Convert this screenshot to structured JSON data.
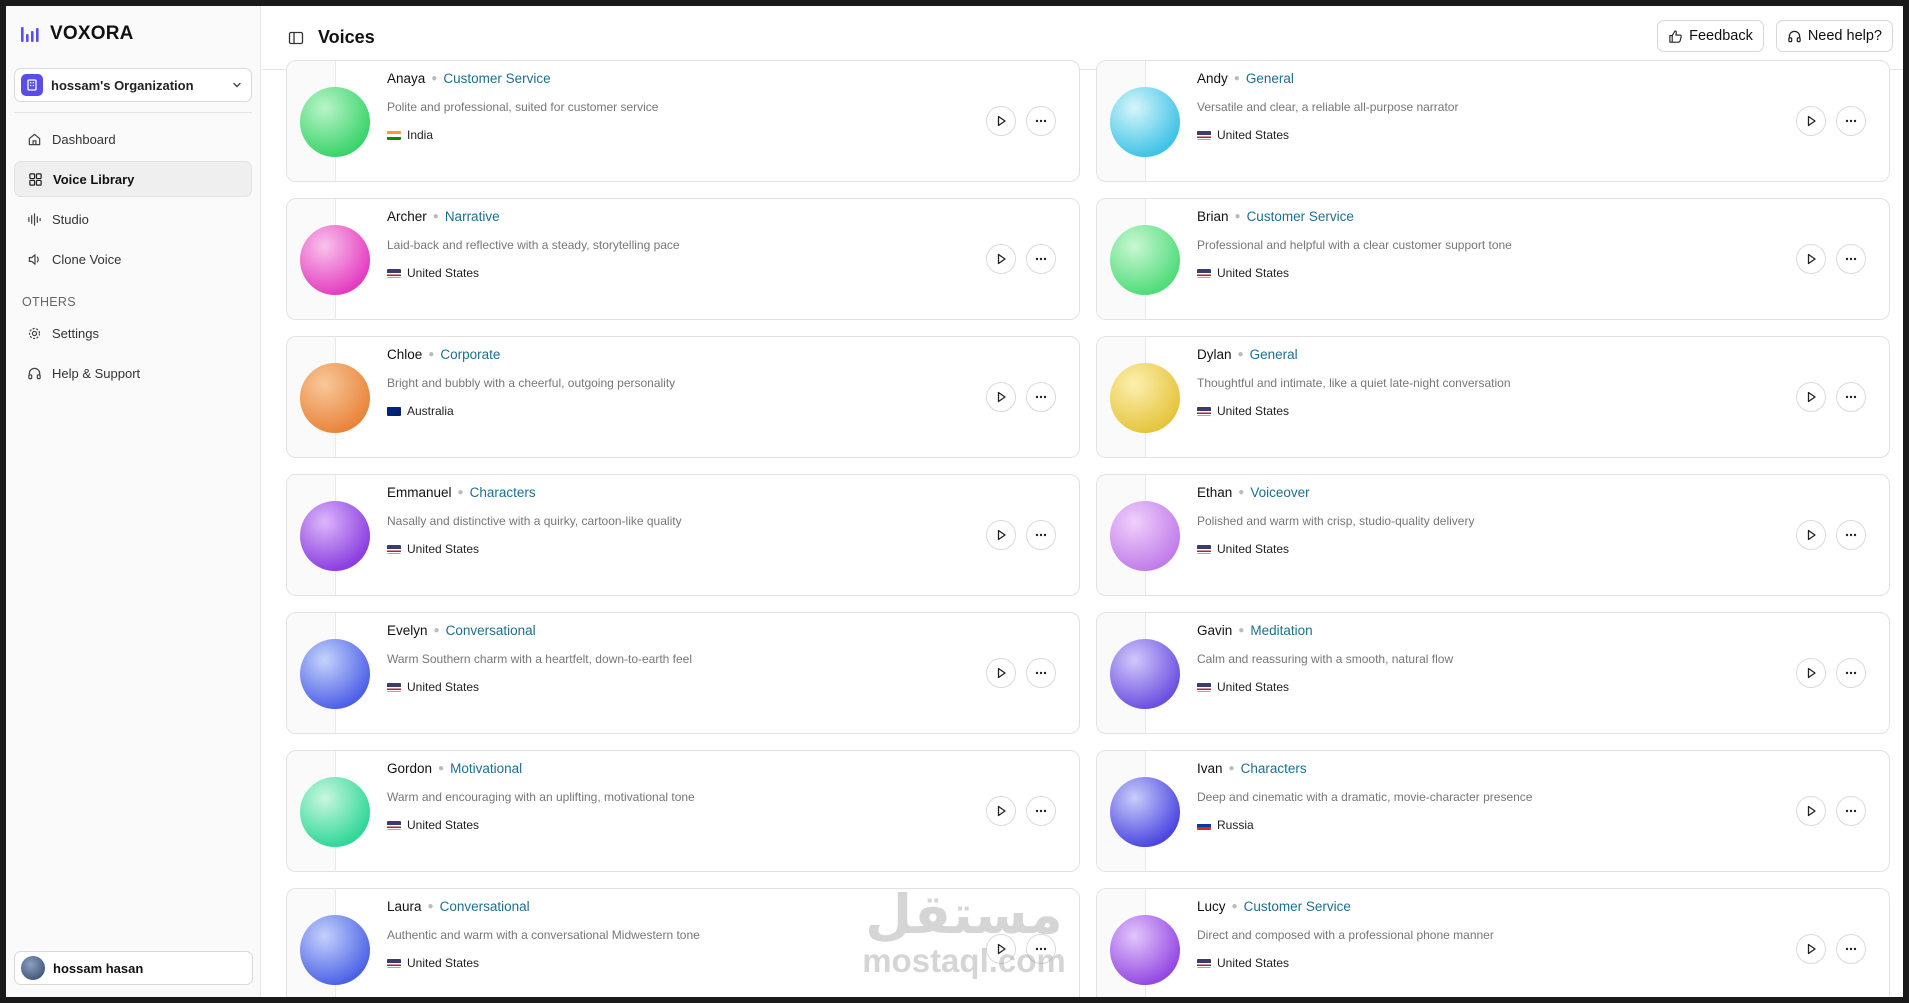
{
  "app": {
    "brand": "VOXORA"
  },
  "sidebar": {
    "org_name": "hossam's Organization",
    "nav": [
      {
        "label": "Dashboard",
        "icon": "home-icon",
        "active": false
      },
      {
        "label": "Voice Library",
        "icon": "grid-icon",
        "active": true
      },
      {
        "label": "Studio",
        "icon": "waveform-icon",
        "active": false
      },
      {
        "label": "Clone Voice",
        "icon": "speaker-icon",
        "active": false
      }
    ],
    "others_label": "OTHERS",
    "others": [
      {
        "label": "Settings",
        "icon": "gear-icon"
      },
      {
        "label": "Help & Support",
        "icon": "headphones-icon"
      }
    ],
    "user_name": "hossam hasan"
  },
  "header": {
    "title": "Voices",
    "feedback_label": "Feedback",
    "help_label": "Need help?"
  },
  "voices": [
    {
      "name": "Anaya",
      "tag": "Customer Service",
      "desc": "Polite and professional, suited for customer service",
      "country": "India",
      "flag": "in",
      "color1": "#b8f5c8",
      "color2": "#3ad36a"
    },
    {
      "name": "Andy",
      "tag": "General",
      "desc": "Versatile and clear, a reliable all-purpose narrator",
      "country": "United States",
      "flag": "us",
      "color1": "#d6f6fb",
      "color2": "#3ec2e6"
    },
    {
      "name": "Archer",
      "tag": "Narrative",
      "desc": "Laid-back and reflective with a steady, storytelling pace",
      "country": "United States",
      "flag": "us",
      "color1": "#f9c2ec",
      "color2": "#e33cc0"
    },
    {
      "name": "Brian",
      "tag": "Customer Service",
      "desc": "Professional and helpful with a clear customer support tone",
      "country": "United States",
      "flag": "us",
      "color1": "#c9f7d3",
      "color2": "#4fdc79"
    },
    {
      "name": "Chloe",
      "tag": "Corporate",
      "desc": "Bright and bubbly with a cheerful, outgoing personality",
      "country": "Australia",
      "flag": "au",
      "color1": "#f8c89a",
      "color2": "#e9843a"
    },
    {
      "name": "Dylan",
      "tag": "General",
      "desc": "Thoughtful and intimate, like a quiet late-night conversation",
      "country": "United States",
      "flag": "us",
      "color1": "#fbf0b0",
      "color2": "#e6c43c"
    },
    {
      "name": "Emmanuel",
      "tag": "Characters",
      "desc": "Nasally and distinctive with a quirky, cartoon-like quality",
      "country": "United States",
      "flag": "us",
      "color1": "#dcb6fa",
      "color2": "#8a3de0"
    },
    {
      "name": "Ethan",
      "tag": "Voiceover",
      "desc": "Polished and warm with crisp, studio-quality delivery",
      "country": "United States",
      "flag": "us",
      "color1": "#efd0fb",
      "color2": "#c17ce9"
    },
    {
      "name": "Evelyn",
      "tag": "Conversational",
      "desc": "Warm Southern charm with a heartfelt, down-to-earth feel",
      "country": "United States",
      "flag": "us",
      "color1": "#c4d4fb",
      "color2": "#4d5fe6"
    },
    {
      "name": "Gavin",
      "tag": "Meditation",
      "desc": "Calm and reassuring with a smooth, natural flow",
      "country": "United States",
      "flag": "us",
      "color1": "#d2c8fb",
      "color2": "#6a4fe0"
    },
    {
      "name": "Gordon",
      "tag": "Motivational",
      "desc": "Warm and encouraging with an uplifting, motivational tone",
      "country": "United States",
      "flag": "us",
      "color1": "#c8f7df",
      "color2": "#2fd796"
    },
    {
      "name": "Ivan",
      "tag": "Characters",
      "desc": "Deep and cinematic with a dramatic, movie-character presence",
      "country": "Russia",
      "flag": "ru",
      "color1": "#c9ccfb",
      "color2": "#4b46e0"
    },
    {
      "name": "Laura",
      "tag": "Conversational",
      "desc": "Authentic and warm with a conversational Midwestern tone",
      "country": "United States",
      "flag": "us",
      "color1": "#c4d2fb",
      "color2": "#4c62e6"
    },
    {
      "name": "Lucy",
      "tag": "Customer Service",
      "desc": "Direct and composed with a professional phone manner",
      "country": "United States",
      "flag": "us",
      "color1": "#e2c6fb",
      "color2": "#9448e2"
    }
  ],
  "watermark": {
    "arabic": "مستقل",
    "latin": "mostaql.com"
  },
  "colors": {
    "accent": "#5b4ee8",
    "tag": "#1d6f8f"
  }
}
